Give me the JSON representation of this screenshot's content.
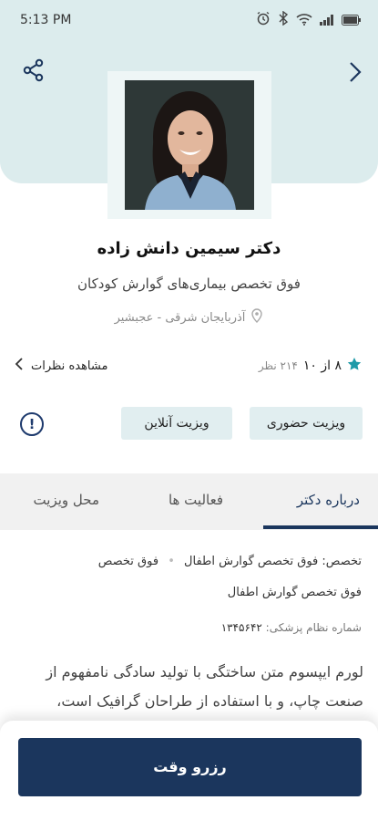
{
  "status_bar": {
    "time": "5:13 PM"
  },
  "doctor": {
    "name": "دکتر سیمین دانش زاده",
    "specialty": "فوق تخصص بیماری‌های گوارش کودکان",
    "location": "آذربایجان شرقی - عجبشیر"
  },
  "rating": {
    "score": "۸ از ۱۰",
    "count": "۲۱۴ نظر",
    "reviews_link": "مشاهده نظرات"
  },
  "visit_buttons": {
    "in_person": "ویزیت حضوری",
    "online": "ویزیت آنلاین",
    "info": "!"
  },
  "tabs": [
    {
      "label": "درباره دکتر",
      "active": true
    },
    {
      "label": "فعالیت ها",
      "active": false
    },
    {
      "label": "محل ویزیت",
      "active": false
    }
  ],
  "about": {
    "specialty_label": "تخصص:",
    "specialty_item1": "فوق تخصص گوارش اطفال",
    "specialty_item2": "فوق تخصص",
    "specialty_item3": "فوق تخصص گوارش اطفال",
    "reg_label": "شماره نظام پزشکی:",
    "reg_number": "۱۳۴۵۶۴۲",
    "description": "لورم ایپسوم متن ساختگی با تولید سادگی نامفهوم از صنعت چاپ، و با استفاده از طراحان گرافیک است،"
  },
  "cta": {
    "reserve": "رزرو وقت"
  },
  "colors": {
    "primary": "#1b365d",
    "header_bg": "#dceced",
    "button_bg": "#e1eef0"
  }
}
